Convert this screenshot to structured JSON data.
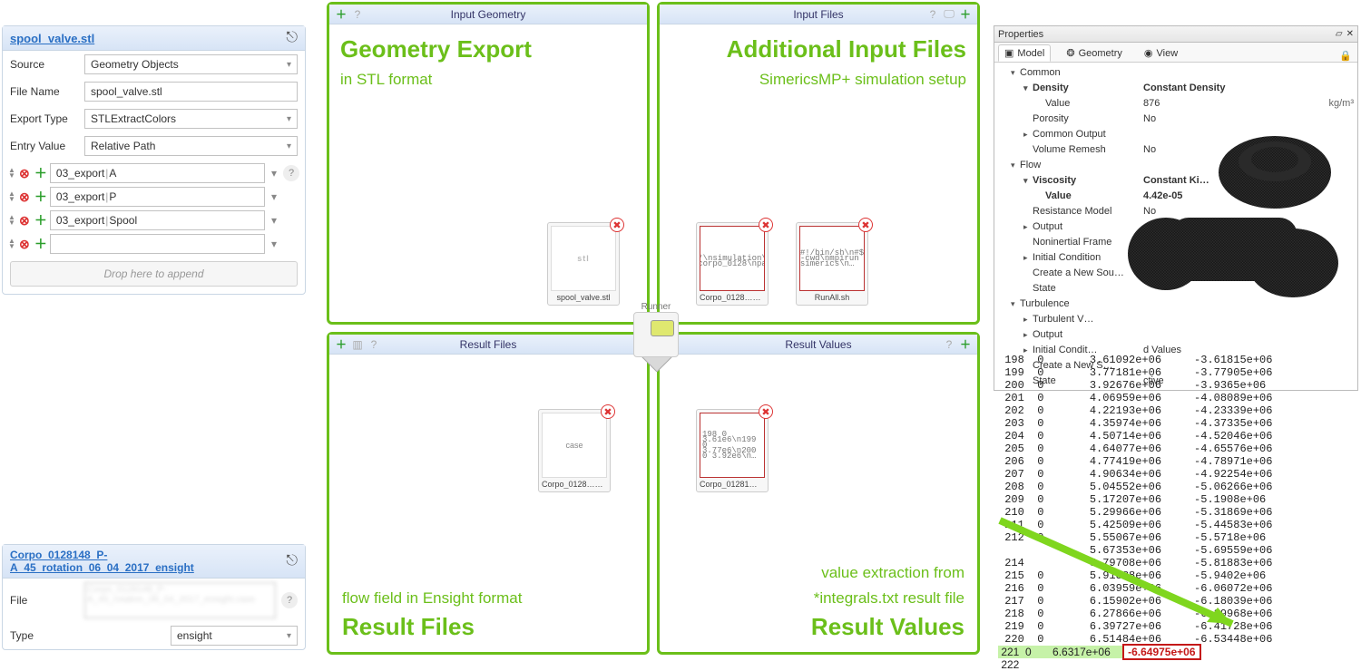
{
  "leftPanel": {
    "title": "spool_valve.stl",
    "rows": {
      "sourceLabel": "Source",
      "sourceValue": "Geometry Objects",
      "fileLabel": "File Name",
      "fileValue": "spool_valve.stl",
      "exportLabel": "Export Type",
      "exportValue": "STLExtractColors",
      "entryLabel": "Entry Value",
      "entryValue": "Relative Path"
    },
    "exports": [
      {
        "prefix": "03_export",
        "val": "A"
      },
      {
        "prefix": "03_export",
        "val": "P"
      },
      {
        "prefix": "03_export",
        "val": "Spool"
      },
      {
        "prefix": "",
        "val": ""
      }
    ],
    "dropHint": "Drop here to append"
  },
  "leftLower": {
    "title": "Corpo_0128148_P-A_45_rotation_06_04_2017_ensight",
    "fileLabel": "File",
    "typeLabel": "Type",
    "typeValue": "ensight"
  },
  "quads": {
    "igHead": "Input Geometry",
    "igTitle": "Geometry Export",
    "igSub": "in STL format",
    "igFile": "spool_valve.stl",
    "ifHead": "Input Files",
    "ifTitle": "Additional Input Files",
    "ifSub": "SimericsMP+ simulation setup",
    "ifFile1": "Corpo_0128…_2017.spro",
    "ifFile2": "RunAll.sh",
    "rfHead": "Result Files",
    "rfTitle": "Result Files",
    "rfSub": "flow field in Ensight format",
    "rfFile": "Corpo_0128…sight.case",
    "rvHead": "Result Values",
    "rvTitle": "Result Values",
    "rvSub1": "value extraction from",
    "rvSub2": "*integrals.txt result file",
    "rvFile": "Corpo_01281…tegrals.txt",
    "runner": "Runner"
  },
  "props": {
    "title": "Properties",
    "tabs": {
      "model": "Model",
      "geometry": "Geometry",
      "view": "View"
    },
    "rows": [
      {
        "i": 1,
        "t": "v",
        "k": "Common",
        "v": "",
        "u": ""
      },
      {
        "i": 2,
        "t": "v",
        "k": "Density",
        "v": "Constant Density",
        "u": "",
        "b": true
      },
      {
        "i": 3,
        "t": "",
        "k": "Value",
        "v": "876",
        "u": "kg/m³"
      },
      {
        "i": 2,
        "t": "",
        "k": "Porosity",
        "v": "No",
        "u": ""
      },
      {
        "i": 2,
        "t": ">",
        "k": "Common Output",
        "v": "",
        "u": ""
      },
      {
        "i": 2,
        "t": "",
        "k": "Volume Remesh",
        "v": "No",
        "u": ""
      },
      {
        "i": 1,
        "t": "v",
        "k": "Flow",
        "v": "",
        "u": ""
      },
      {
        "i": 2,
        "t": "v",
        "k": "Viscosity",
        "v": "Constant Ki…",
        "u": "",
        "b": true
      },
      {
        "i": 3,
        "t": "",
        "k": "Value",
        "v": "4.42e-05",
        "u": "",
        "b": true
      },
      {
        "i": 2,
        "t": "",
        "k": "Resistance Model",
        "v": "No",
        "u": ""
      },
      {
        "i": 2,
        "t": ">",
        "k": "Output",
        "v": "",
        "u": ""
      },
      {
        "i": 2,
        "t": "",
        "k": "Noninertial Frame",
        "v": "",
        "u": ""
      },
      {
        "i": 2,
        "t": ">",
        "k": "Initial Condition",
        "v": "",
        "u": ""
      },
      {
        "i": 2,
        "t": "",
        "k": "Create a New Sou…",
        "v": "",
        "u": ""
      },
      {
        "i": 2,
        "t": "",
        "k": "State",
        "v": "",
        "u": ""
      },
      {
        "i": 1,
        "t": "v",
        "k": "Turbulence",
        "v": "",
        "u": ""
      },
      {
        "i": 2,
        "t": ">",
        "k": "Turbulent V…",
        "v": "",
        "u": ""
      },
      {
        "i": 2,
        "t": ">",
        "k": "Output",
        "v": "",
        "u": ""
      },
      {
        "i": 2,
        "t": ">",
        "k": "Initial Condit…",
        "v": "d Values",
        "u": ""
      },
      {
        "i": 2,
        "t": "",
        "k": "Create a New S…",
        "v": "",
        "u": ""
      },
      {
        "i": 2,
        "t": "",
        "k": "State",
        "v": "ctive",
        "u": ""
      }
    ]
  },
  "dump": {
    "rows": [
      {
        "n": "198",
        "a": "0",
        "b": "3.61092e+06",
        "c": "-3.61815e+06"
      },
      {
        "n": "199",
        "a": "0",
        "b": "3.77181e+06",
        "c": "-3.77905e+06"
      },
      {
        "n": "200",
        "a": "0",
        "b": "3.92676e+06",
        "c": "-3.9365e+06"
      },
      {
        "n": "201",
        "a": "0",
        "b": "4.06959e+06",
        "c": "-4.08089e+06"
      },
      {
        "n": "202",
        "a": "0",
        "b": "4.22193e+06",
        "c": "-4.23339e+06"
      },
      {
        "n": "203",
        "a": "0",
        "b": "4.35974e+06",
        "c": "-4.37335e+06"
      },
      {
        "n": "204",
        "a": "0",
        "b": "4.50714e+06",
        "c": "-4.52046e+06"
      },
      {
        "n": "205",
        "a": "0",
        "b": "4.64077e+06",
        "c": "-4.65576e+06"
      },
      {
        "n": "206",
        "a": "0",
        "b": "4.77419e+06",
        "c": "-4.78971e+06"
      },
      {
        "n": "207",
        "a": "0",
        "b": "4.90634e+06",
        "c": "-4.92254e+06"
      },
      {
        "n": "208",
        "a": "0",
        "b": "5.04552e+06",
        "c": "-5.06266e+06"
      },
      {
        "n": "209",
        "a": "0",
        "b": "5.17207e+06",
        "c": "-5.1908e+06"
      },
      {
        "n": "210",
        "a": "0",
        "b": "5.29966e+06",
        "c": "-5.31869e+06"
      },
      {
        "n": "211",
        "a": "0",
        "b": "5.42509e+06",
        "c": "-5.44583e+06"
      },
      {
        "n": "212",
        "a": "0",
        "b": "5.55067e+06",
        "c": "-5.5718e+06"
      },
      {
        "n": "",
        "a": "",
        "b": "5.67353e+06",
        "c": "-5.69559e+06"
      },
      {
        "n": "214",
        "a": "",
        "b": "5.79708e+06",
        "c": "-5.81883e+06"
      },
      {
        "n": "215",
        "a": "0",
        "b": "5.91888e+06",
        "c": "-5.9402e+06"
      },
      {
        "n": "216",
        "a": "0",
        "b": "6.03959e+06",
        "c": "-6.06072e+06"
      },
      {
        "n": "217",
        "a": "0",
        "b": "6.15902e+06",
        "c": "-6.18039e+06"
      },
      {
        "n": "218",
        "a": "0",
        "b": "6.27866e+06",
        "c": "-6.29968e+06"
      },
      {
        "n": "219",
        "a": "0",
        "b": "6.39727e+06",
        "c": "-6.41728e+06"
      },
      {
        "n": "220",
        "a": "0",
        "b": "6.51484e+06",
        "c": "-6.53448e+06"
      }
    ],
    "hiRow": {
      "n": "221",
      "a": "0",
      "b": "6.6317e+06"
    },
    "hiVal": "-6.64975e+06",
    "lastN": "222"
  }
}
